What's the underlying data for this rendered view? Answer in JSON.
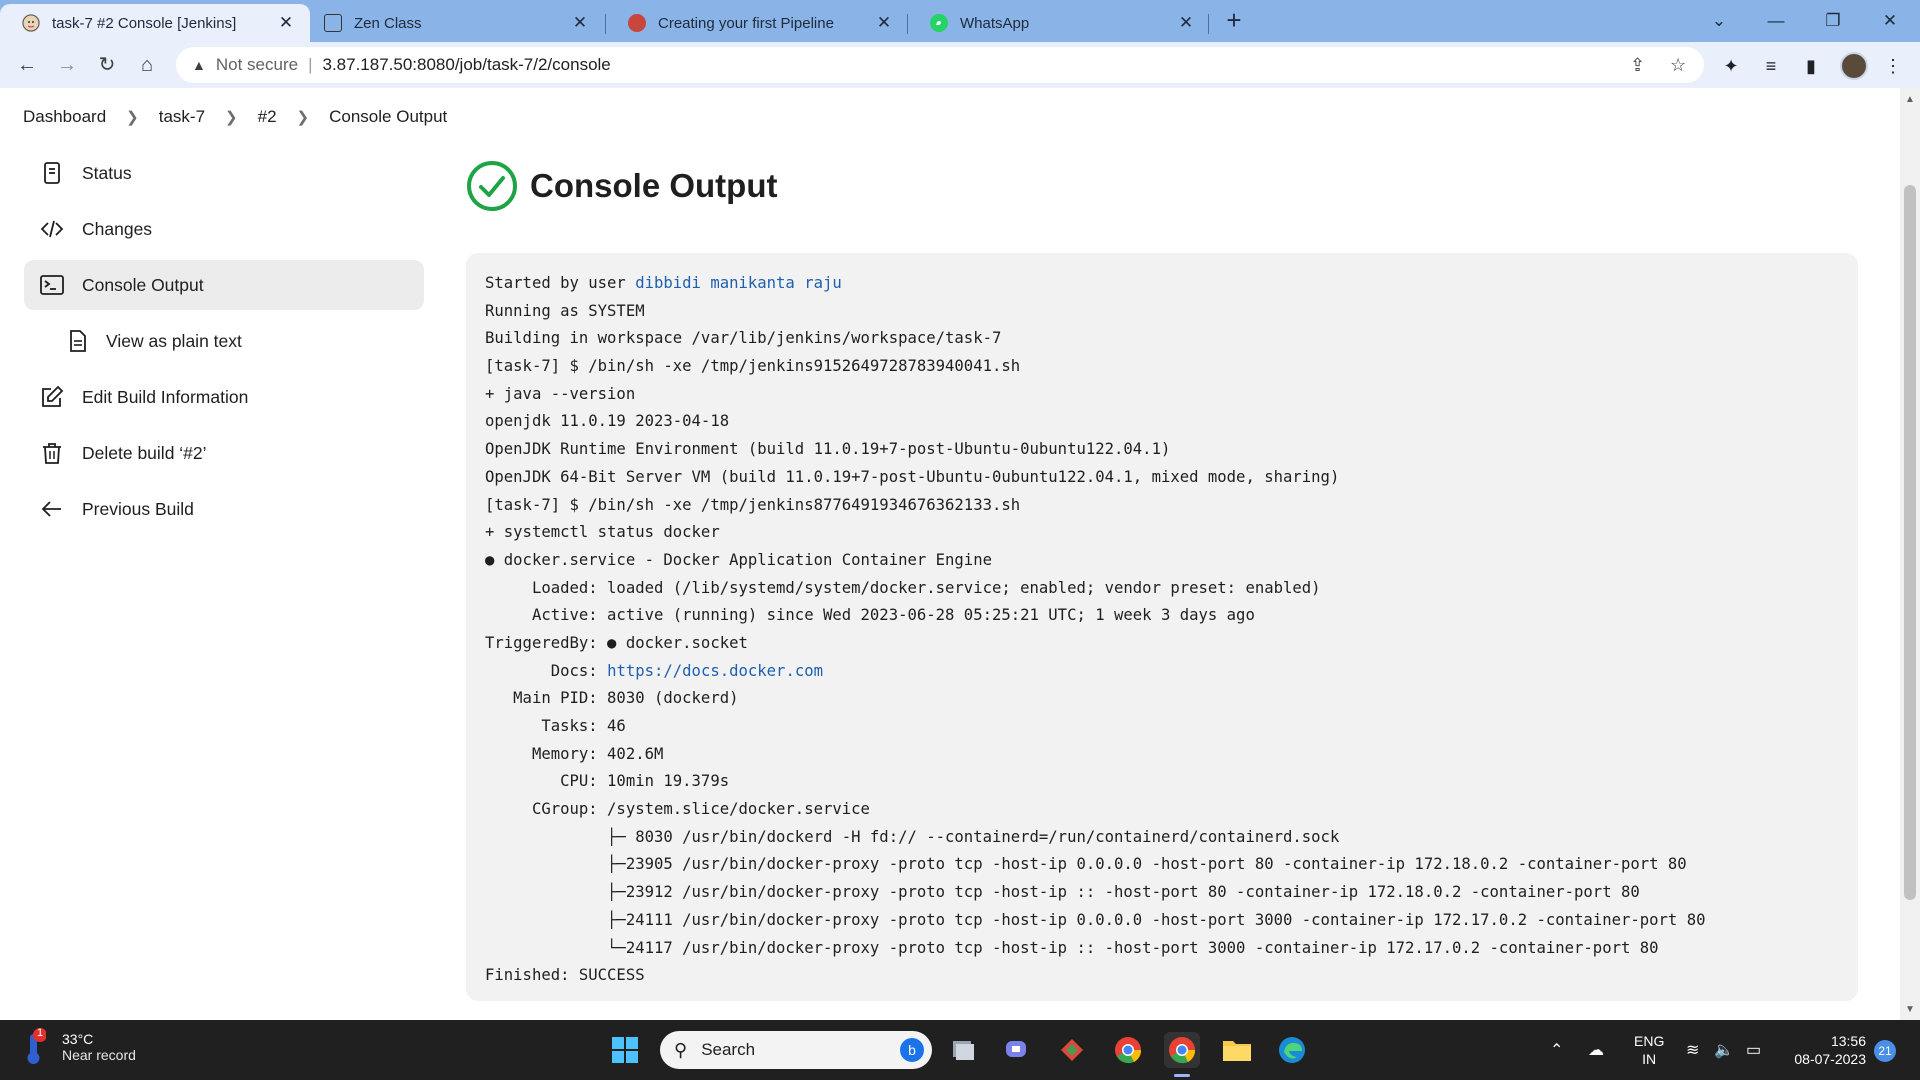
{
  "browser": {
    "tabs": [
      {
        "title": "task-7 #2 Console [Jenkins]",
        "active": true,
        "icon": "jenkins-icon"
      },
      {
        "title": "Zen Class",
        "active": false,
        "icon": "zen-class-icon"
      },
      {
        "title": "Creating your first Pipeline",
        "active": false,
        "icon": "jenkins-icon"
      },
      {
        "title": "WhatsApp",
        "active": false,
        "icon": "whatsapp-icon"
      }
    ],
    "security_label": "Not secure",
    "url": "3.87.187.50:8080/job/task-7/2/console"
  },
  "breadcrumb": {
    "items": [
      "Dashboard",
      "task-7",
      "#2",
      "Console Output"
    ]
  },
  "sidebar": {
    "items": [
      {
        "label": "Status",
        "icon": "status-icon"
      },
      {
        "label": "Changes",
        "icon": "code-icon"
      },
      {
        "label": "Console Output",
        "icon": "terminal-icon"
      },
      {
        "label": "View as plain text",
        "icon": "document-icon"
      },
      {
        "label": "Edit Build Information",
        "icon": "edit-icon"
      },
      {
        "label": "Delete build ‘#2’",
        "icon": "trash-icon"
      },
      {
        "label": "Previous Build",
        "icon": "arrow-left-icon"
      }
    ]
  },
  "page": {
    "title": "Console Output",
    "status": "success"
  },
  "console": {
    "started_prefix": "Started by user ",
    "started_user": "dibbidi manikanta raju",
    "lines": [
      "Running as SYSTEM",
      "Building in workspace /var/lib/jenkins/workspace/task-7",
      "[task-7] $ /bin/sh -xe /tmp/jenkins9152649728783940041.sh",
      "+ java --version",
      "openjdk 11.0.19 2023-04-18",
      "OpenJDK Runtime Environment (build 11.0.19+7-post-Ubuntu-0ubuntu122.04.1)",
      "OpenJDK 64-Bit Server VM (build 11.0.19+7-post-Ubuntu-0ubuntu122.04.1, mixed mode, sharing)",
      "[task-7] $ /bin/sh -xe /tmp/jenkins8776491934676362133.sh",
      "+ systemctl status docker",
      "● docker.service - Docker Application Container Engine",
      "     Loaded: loaded (/lib/systemd/system/docker.service; enabled; vendor preset: enabled)",
      "     Active: active (running) since Wed 2023-06-28 05:25:21 UTC; 1 week 3 days ago",
      "TriggeredBy: ● docker.socket"
    ],
    "docs_prefix": "       Docs: ",
    "docs_url": "https://docs.docker.com",
    "lines2": [
      "   Main PID: 8030 (dockerd)",
      "      Tasks: 46",
      "     Memory: 402.6M",
      "        CPU: 10min 19.379s",
      "     CGroup: /system.slice/docker.service",
      "             ├─ 8030 /usr/bin/dockerd -H fd:// --containerd=/run/containerd/containerd.sock",
      "             ├─23905 /usr/bin/docker-proxy -proto tcp -host-ip 0.0.0.0 -host-port 80 -container-ip 172.18.0.2 -container-port 80",
      "             ├─23912 /usr/bin/docker-proxy -proto tcp -host-ip :: -host-port 80 -container-ip 172.18.0.2 -container-port 80",
      "             ├─24111 /usr/bin/docker-proxy -proto tcp -host-ip 0.0.0.0 -host-port 3000 -container-ip 172.17.0.2 -container-port 80",
      "             └─24117 /usr/bin/docker-proxy -proto tcp -host-ip :: -host-port 3000 -container-ip 172.17.0.2 -container-port 80",
      "Finished: SUCCESS"
    ]
  },
  "taskbar": {
    "weather_badge": "1",
    "temperature": "33°C",
    "weather_desc": "Near record",
    "search_label": "Search",
    "lang_top": "ENG",
    "lang_bottom": "IN",
    "time": "13:56",
    "date": "08-07-2023",
    "notifications": "21"
  },
  "colors": {
    "tabstrip": "#8ab4e8",
    "toolbar": "#e9effb",
    "success_green": "#1ea446",
    "link_blue": "#1d5fb0",
    "console_bg": "#f2f2f2"
  }
}
